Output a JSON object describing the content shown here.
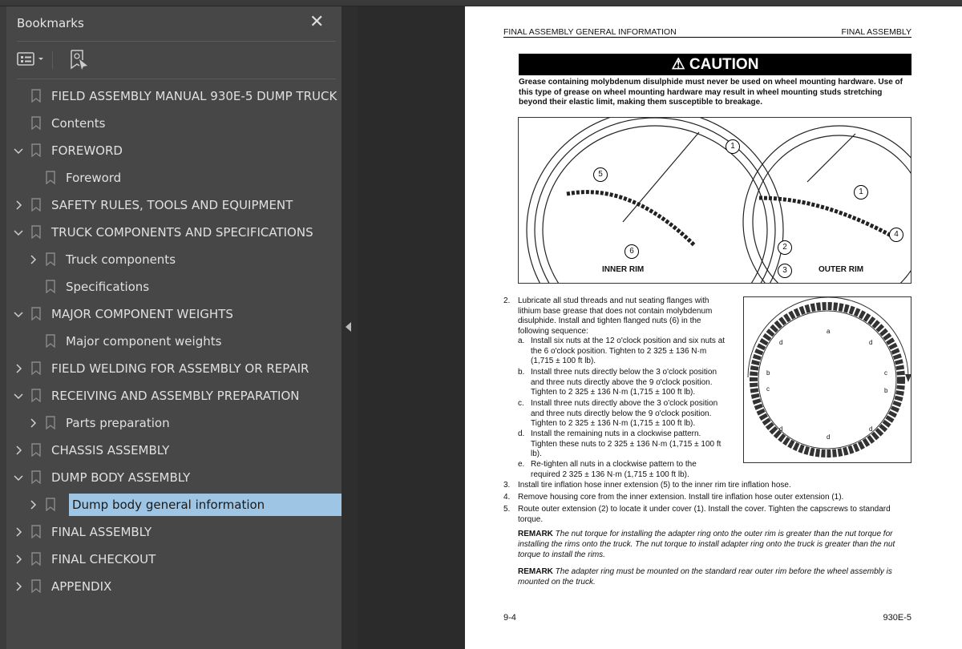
{
  "sidebar": {
    "title": "Bookmarks",
    "close": "✕",
    "items": [
      {
        "label": "FIELD ASSEMBLY MANUAL 930E-5 DUMP TRUCK",
        "level": 0,
        "chevron": "none"
      },
      {
        "label": "Contents",
        "level": 0,
        "chevron": "none"
      },
      {
        "label": "FOREWORD",
        "level": 0,
        "chevron": "expanded"
      },
      {
        "label": "Foreword",
        "level": 1,
        "chevron": "none"
      },
      {
        "label": "SAFETY RULES, TOOLS AND EQUIPMENT",
        "level": 0,
        "chevron": "collapsed"
      },
      {
        "label": "TRUCK COMPONENTS AND SPECIFICATIONS",
        "level": 0,
        "chevron": "expanded"
      },
      {
        "label": "Truck components",
        "level": 1,
        "chevron": "collapsed"
      },
      {
        "label": "Specifications",
        "level": 1,
        "chevron": "none"
      },
      {
        "label": "MAJOR COMPONENT WEIGHTS",
        "level": 0,
        "chevron": "expanded"
      },
      {
        "label": "Major component weights",
        "level": 1,
        "chevron": "none"
      },
      {
        "label": "FIELD WELDING FOR ASSEMBLY OR REPAIR",
        "level": 0,
        "chevron": "collapsed"
      },
      {
        "label": "RECEIVING AND ASSEMBLY PREPARATION",
        "level": 0,
        "chevron": "expanded"
      },
      {
        "label": "Parts preparation",
        "level": 1,
        "chevron": "collapsed"
      },
      {
        "label": "CHASSIS ASSEMBLY",
        "level": 0,
        "chevron": "collapsed"
      },
      {
        "label": "DUMP BODY ASSEMBLY",
        "level": 0,
        "chevron": "expanded"
      },
      {
        "label": "Dump body general information",
        "level": 1,
        "chevron": "collapsed",
        "selected": true
      },
      {
        "label": "FINAL ASSEMBLY",
        "level": 0,
        "chevron": "collapsed"
      },
      {
        "label": "FINAL CHECKOUT",
        "level": 0,
        "chevron": "collapsed"
      },
      {
        "label": "APPENDIX",
        "level": 0,
        "chevron": "collapsed"
      }
    ],
    "selected_color": "#9fc5e4"
  },
  "page": {
    "header_left": "FINAL ASSEMBLY GENERAL INFORMATION",
    "header_right": "FINAL ASSEMBLY",
    "caution_title": "CAUTION",
    "caution_text": "Grease containing molybdenum disulphide must never be used on wheel mounting hardware. Use of this type of grease on wheel mounting hardware may result in wheel mounting studs stretching beyond their elastic limit, making them susceptible to breakage.",
    "figure1": {
      "inner_label": "INNER RIM",
      "outer_label": "OUTER RIM",
      "callouts": [
        "1",
        "5",
        "6",
        "1",
        "2",
        "3",
        "4"
      ]
    },
    "figure2": {
      "labels": [
        "a",
        "b",
        "c",
        "d"
      ]
    },
    "step2": "Lubricate all stud threads and nut seating flanges with lithium base grease that does not contain molybdenum disulphide. Install and tighten flanged nuts (6) in the following sequence:",
    "substeps": [
      {
        "l": "a.",
        "t": "Install six nuts at the 12 o'clock position and six nuts at the 6 o'clock position. Tighten to 2 325 ± 136 N·m (1,715 ± 100 ft lb)."
      },
      {
        "l": "b.",
        "t": "Install three nuts directly below the 3 o'clock position and three nuts directly above the 9 o'clock position. Tighten to 2 325 ± 136 N·m (1,715 ± 100 ft lb)."
      },
      {
        "l": "c.",
        "t": "Install three nuts directly above the 3 o'clock position and three nuts directly below the 9 o'clock position. Tighten to 2 325 ± 136 N·m (1,715 ± 100 ft lb)."
      },
      {
        "l": "d.",
        "t": "Install the remaining nuts in a clockwise pattern. Tighten these nuts to 2 325 ± 136 N·m (1,715 ± 100 ft lb)."
      },
      {
        "l": "e.",
        "t": "Re-tighten all nuts in a clockwise pattern to the required 2 325 ± 136 N·m (1,715 ± 100 ft lb)."
      }
    ],
    "steps": [
      {
        "n": "3.",
        "t": "Install tire inflation hose inner extension (5) to the inner rim tire inflation hose."
      },
      {
        "n": "4.",
        "t": "Remove housing core from the inner extension. Install tire inflation hose outer extension (1)."
      },
      {
        "n": "5.",
        "t": "Route outer extension (2) to locate it under cover (1). Install the cover. Tighten the capscrews to standard torque."
      }
    ],
    "remark_label": "REMARK",
    "remark1": "The nut torque for installing the adapter ring onto the outer rim is greater than the nut torque for installing the rims onto the truck. The nut torque to install adapter ring onto the truck is greater than the nut torque to install the rims.",
    "remark2": "The adapter ring must be mounted on the standard rear outer rim before the wheel assembly is mounted on the truck.",
    "footer_left": "9-4",
    "footer_right": "930E-5"
  }
}
